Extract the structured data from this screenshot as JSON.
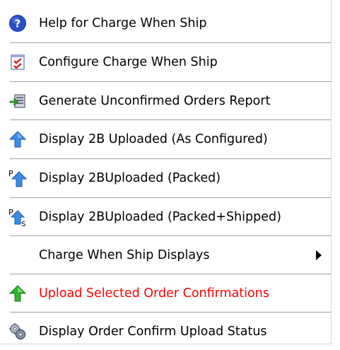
{
  "menu": {
    "items": [
      {
        "label": "Help for Charge When Ship",
        "icon": "help-icon"
      },
      {
        "label": "Configure Charge When Ship",
        "icon": "configure-icon"
      },
      {
        "label": "Generate Unconfirmed Orders Report",
        "icon": "report-icon"
      },
      {
        "label": "Display 2B Uploaded (As Configured)",
        "icon": "blue-up-arrow-icon"
      },
      {
        "label": "Display 2BUploaded (Packed)",
        "icon": "blue-up-arrow-packed-icon"
      },
      {
        "label": "Display 2BUploaded (Packed+Shipped)",
        "icon": "blue-up-arrow-packed-shipped-icon"
      },
      {
        "label": "Charge When Ship Displays",
        "icon": "",
        "has_submenu": true
      },
      {
        "label": "Upload Selected Order Confirmations",
        "icon": "green-up-arrow-icon",
        "color": "#ff0000"
      },
      {
        "label": "Display Order Confirm Upload Status",
        "icon": "status-icon"
      }
    ]
  },
  "colors": {
    "separator": "#a0a0a0",
    "highlight_text": "#ff0000",
    "text": "#000000"
  }
}
